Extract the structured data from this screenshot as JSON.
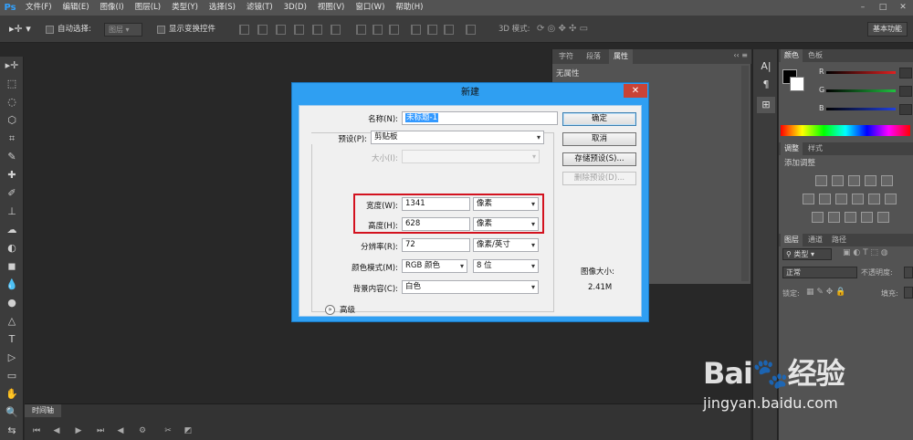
{
  "app": {
    "logo": "Ps"
  },
  "menu": [
    "文件(F)",
    "编辑(E)",
    "图像(I)",
    "图层(L)",
    "类型(Y)",
    "选择(S)",
    "滤镜(T)",
    "3D(D)",
    "视图(V)",
    "窗口(W)",
    "帮助(H)"
  ],
  "window_controls": {
    "minimize": "–",
    "restore": "□",
    "close": "✕"
  },
  "options": {
    "auto_select_label": "自动选择:",
    "auto_select_value": "图层",
    "show_transform_label": "显示变换控件",
    "mode_3d_label": "3D 模式:",
    "workspace_button": "基本功能"
  },
  "tools": [
    "▸✛",
    "⬚",
    "◌",
    "⬡",
    "⌗",
    "✎",
    "✚",
    "✐",
    "⊥",
    "☁",
    "◐",
    "◼",
    "💧",
    "●",
    "△",
    "T",
    "▷",
    "▭",
    "✋",
    "🔍",
    "⇆"
  ],
  "timeline": {
    "tab": "时间轴"
  },
  "mid_panel": {
    "tabs": [
      "字符",
      "段落",
      "属性"
    ],
    "properties_title": "无属性"
  },
  "icon_column": [
    "A|",
    "¶",
    "⊞"
  ],
  "color_panel": {
    "tabs": [
      "颜色",
      "色板"
    ],
    "channels": [
      {
        "label": "R",
        "color": "#e02020"
      },
      {
        "label": "G",
        "color": "#20c040"
      },
      {
        "label": "B",
        "color": "#2040e0"
      }
    ],
    "foreground": "#000000",
    "background": "#ffffff"
  },
  "adjustments_panel": {
    "tabs": [
      "调整",
      "样式"
    ],
    "title": "添加调整"
  },
  "layers_panel": {
    "tabs": [
      "图层",
      "通道",
      "路径"
    ],
    "kind_label": "类型",
    "blend_mode": "正常",
    "opacity_label": "不透明度:",
    "lock_label": "锁定:",
    "fill_label": "填充:"
  },
  "dialog": {
    "title": "新建",
    "close": "✕",
    "name_label": "名称(N):",
    "name_value": "未标题-1",
    "preset_label": "预设(P):",
    "preset_value": "剪贴板",
    "size_label": "大小(I):",
    "size_value": "",
    "width_label": "宽度(W):",
    "width_value": "1341",
    "width_unit": "像素",
    "height_label": "高度(H):",
    "height_value": "628",
    "height_unit": "像素",
    "resolution_label": "分辨率(R):",
    "resolution_value": "72",
    "resolution_unit": "像素/英寸",
    "color_mode_label": "颜色模式(M):",
    "color_mode_value": "RGB 颜色",
    "bit_depth_value": "8 位",
    "background_label": "背景内容(C):",
    "background_value": "白色",
    "advanced_label": "高级",
    "ok_button": "确定",
    "cancel_button": "取消",
    "save_preset_button": "存储预设(S)...",
    "delete_preset_button": "删除预设(D)...",
    "image_size_label": "图像大小:",
    "image_size_value": "2.41M",
    "highlight_color": "#d3121f"
  },
  "watermark": {
    "logo": "Bai🐾经验",
    "url": "jingyan.baidu.com"
  }
}
